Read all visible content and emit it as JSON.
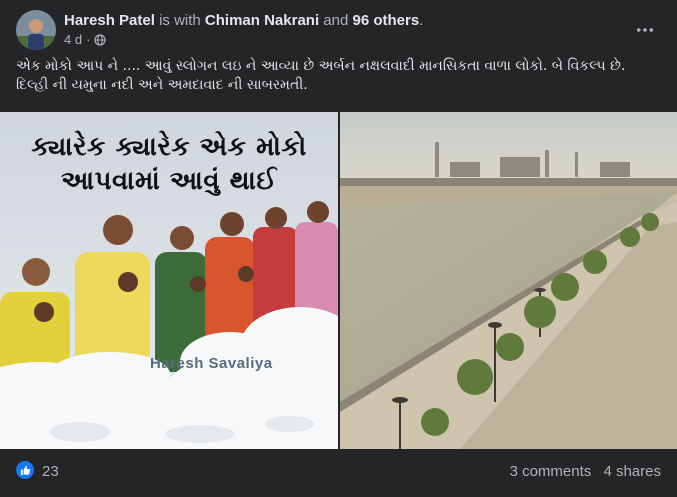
{
  "post": {
    "author": "Haresh Patel",
    "with_text": "is with",
    "tagged": "Chiman Nakrani",
    "and_text": "and",
    "others": "96 others",
    "period": ".",
    "time": "4 d",
    "separator": "·",
    "privacy_icon": "globe-icon",
    "more_icon": "more-options-icon",
    "text_line1": "એક મોકો આપ ને ....  આવું સ્લોગન લઇ ને આવ્યા છે અર્બન નક્ષલવાદી માનસિકતા વાળા લોકો.  બે વિકલ્પ છે.",
    "text_line2": " દિલ્હી ની યમુના નદી અને અમદાવાદ ની સાબરમતી."
  },
  "images": {
    "left": {
      "title_line1": "ક્યારેક ક્યારેક એક મોકો",
      "title_line2": "આપવામાં આવું થાઈ",
      "watermark": "Haresh Savaliya"
    },
    "right": {}
  },
  "footer": {
    "like_icon": "thumbs-up-icon",
    "reactions_count": "23",
    "comments": "3 comments",
    "shares": "4 shares"
  },
  "colors": {
    "background": "#242526",
    "primary_text": "#e4e6eb",
    "secondary_text": "#b0b3b8",
    "like_blue": "#1877f2"
  }
}
